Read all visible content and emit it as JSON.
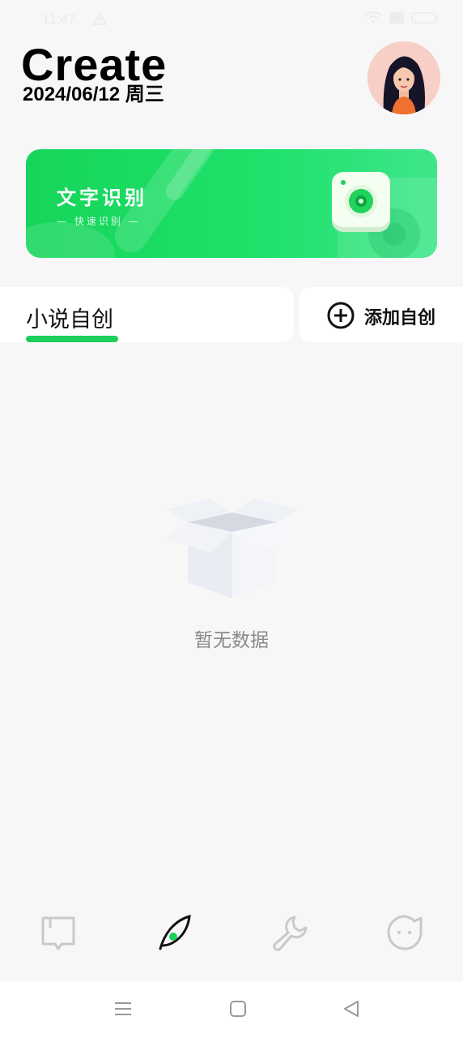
{
  "status_bar": {
    "time": "11:47",
    "icons": [
      "warning-icon",
      "wifi-icon",
      "sim-icon",
      "battery-icon"
    ]
  },
  "header": {
    "title": "Create",
    "date": "2024/06/12 周三",
    "avatar": "girl-avatar"
  },
  "banner": {
    "title": "文字识别",
    "subtitle": "— 快速识别 —",
    "icon": "camera-icon",
    "accent_color": "#1bd45c"
  },
  "tabs": {
    "active_label": "小说自创",
    "add_label": "添加自创",
    "underline_color": "#1bcf5a"
  },
  "empty_state": {
    "icon": "empty-box-icon",
    "text": "暂无数据"
  },
  "bottom_nav": {
    "items": [
      {
        "icon": "book-icon",
        "active": false
      },
      {
        "icon": "feather-pen-icon",
        "active": true
      },
      {
        "icon": "wrench-icon",
        "active": false
      },
      {
        "icon": "face-icon",
        "active": false
      }
    ]
  },
  "system_nav": [
    "menu-icon",
    "home-square-icon",
    "back-triangle-icon"
  ]
}
